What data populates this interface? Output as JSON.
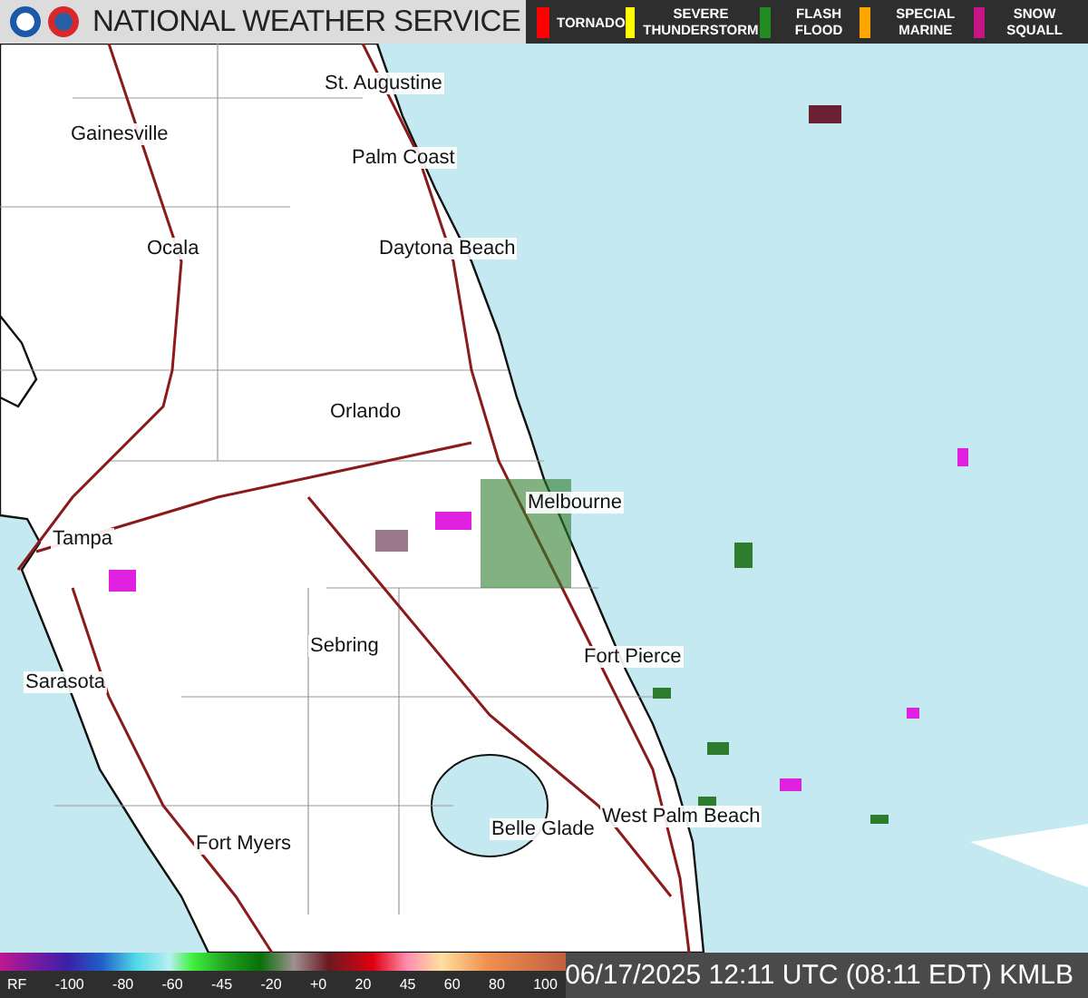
{
  "header": {
    "title": "NATIONAL WEATHER SERVICE"
  },
  "warnings": [
    {
      "label": "TORNADO",
      "color": "#ff0000"
    },
    {
      "label": "SEVERE THUNDERSTORM",
      "color": "#ffff00"
    },
    {
      "label": "FLASH FLOOD",
      "color": "#228b22"
    },
    {
      "label": "SPECIAL MARINE",
      "color": "#ffa500"
    },
    {
      "label": "SNOW SQUALL",
      "color": "#c71585"
    }
  ],
  "cities": [
    "St. Augustine",
    "Gainesville",
    "Palm Coast",
    "Ocala",
    "Daytona Beach",
    "Orlando",
    "Melbourne",
    "Tampa",
    "Sebring",
    "Sarasota",
    "Fort Pierce",
    "West Palm Beach",
    "Belle Glade",
    "Fort Myers"
  ],
  "scale": {
    "unit": "RF",
    "ticks": [
      "-100",
      "-80",
      "-60",
      "-45",
      "-20",
      "+0",
      "20",
      "45",
      "60",
      "80",
      "100"
    ]
  },
  "timestamp": "06/17/2025 12:11 UTC (08:11 EDT) KMLB"
}
